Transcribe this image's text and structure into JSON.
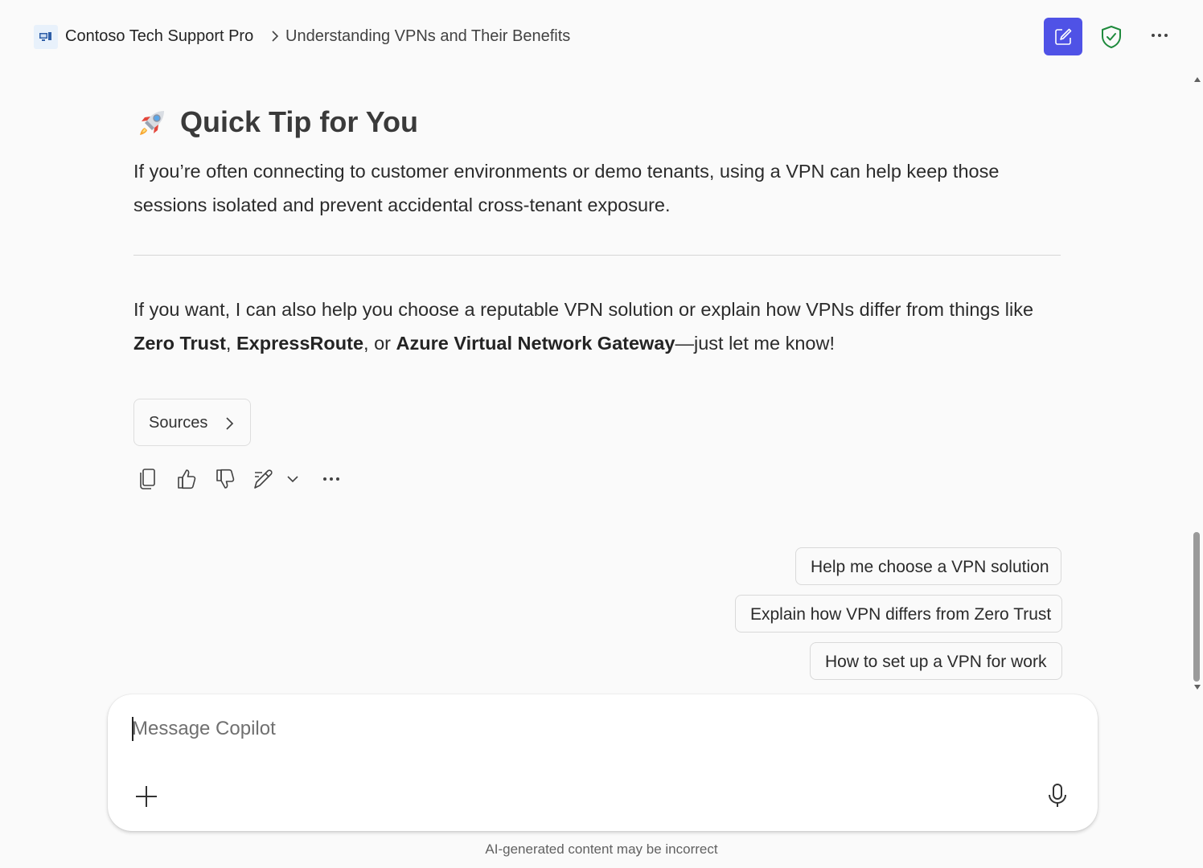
{
  "header": {
    "app_name": "Contoso Tech Support Pro",
    "conversation_title": "Understanding VPNs and Their Benefits",
    "accent_color": "#4f52e6",
    "icons": [
      "app-icon",
      "chevron-right-icon",
      "new-chat-icon",
      "shield-check-icon",
      "more-icon"
    ]
  },
  "message": {
    "tip_heading": "Quick Tip for You",
    "tip_paragraph": "If you’re often connecting to customer environments or demo tenants, using a VPN can help keep those sessions isolated and prevent accidental cross-tenant exposure.",
    "follow_up": {
      "intro": "If you want, I can also help you choose a reputable VPN solution or explain how VPNs differ from things like ",
      "term1": "Zero Trust",
      "sep1": ", ",
      "term2": "ExpressRoute",
      "sep2": ", or ",
      "term3": "Azure Virtual Network Gateway",
      "outro": "—just let me know!"
    },
    "sources_label": "Sources",
    "action_icons": [
      "copy-icon",
      "thumbs-up-icon",
      "thumbs-down-icon",
      "edit-icon",
      "chevron-down-icon",
      "more-icon"
    ]
  },
  "suggestions": [
    "Help me choose a VPN solution",
    "Explain how VPN differs from Zero Trust",
    "How to set up a VPN for work"
  ],
  "composer": {
    "placeholder": "Message Copilot",
    "value": ""
  },
  "disclaimer": "AI-generated content may be incorrect"
}
